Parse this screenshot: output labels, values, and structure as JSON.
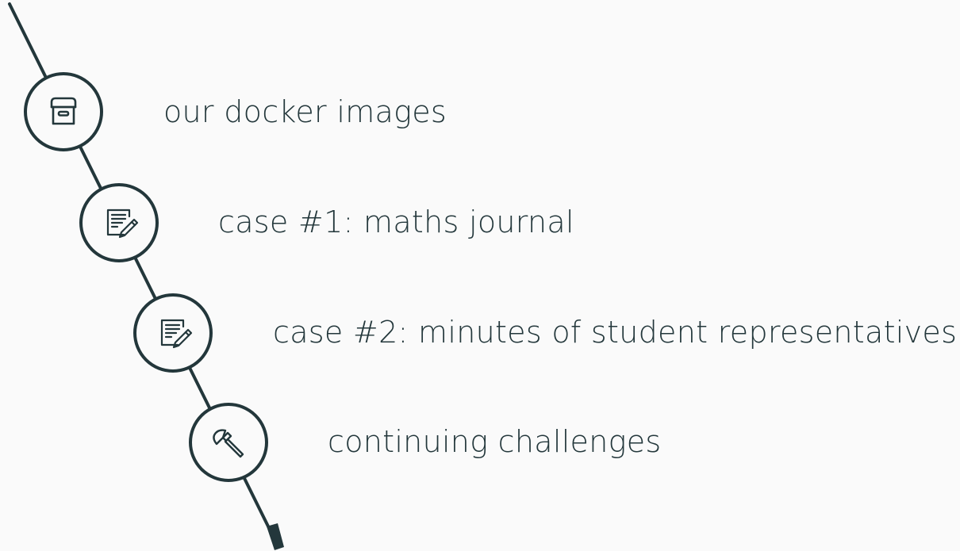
{
  "agenda": {
    "items": [
      {
        "label": "our docker images",
        "icon": "archive-box-icon"
      },
      {
        "label": "case #1: maths journal",
        "icon": "edit-note-icon"
      },
      {
        "label": "case #2: minutes of student representatives",
        "icon": "edit-note-icon"
      },
      {
        "label": "continuing challenges",
        "icon": "axe-icon"
      }
    ]
  },
  "colors": {
    "background": "#fafafa",
    "line": "#23373b",
    "text": "#23373b"
  }
}
